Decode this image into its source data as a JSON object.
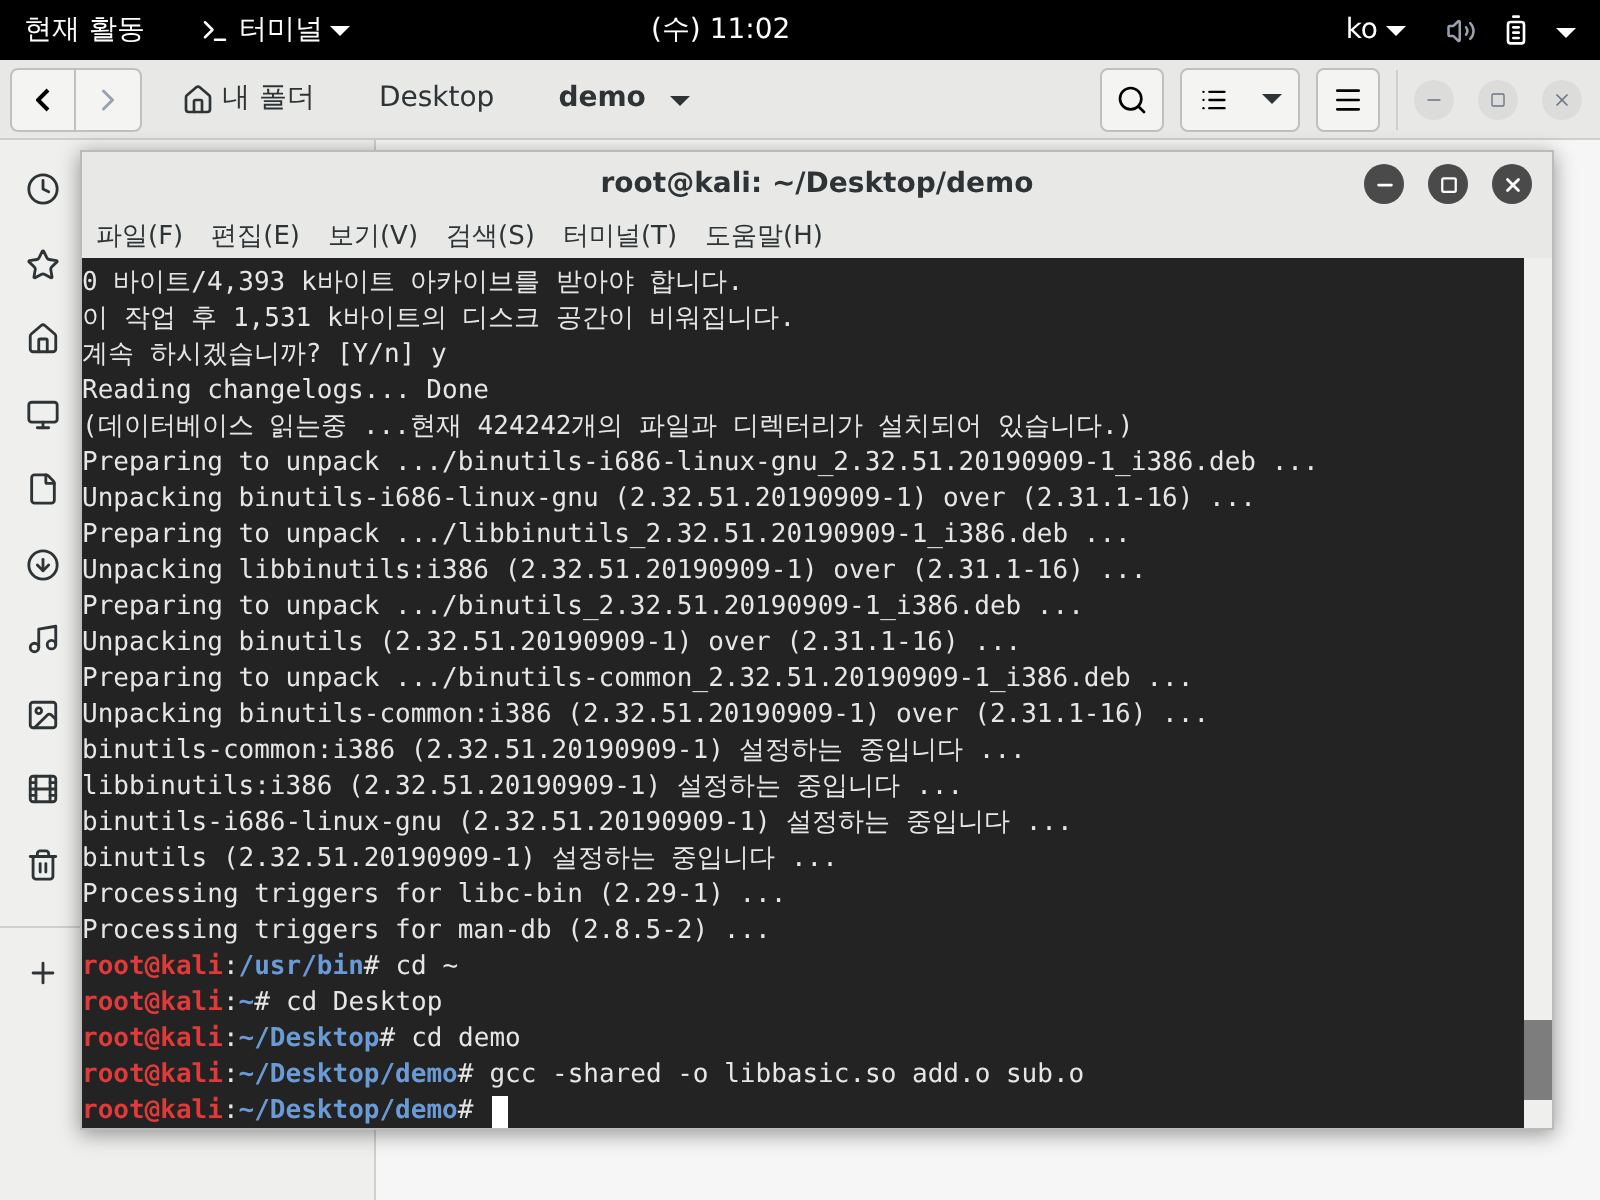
{
  "top_bar": {
    "activities": "현재 활동",
    "app_menu": "터미널",
    "clock": "(수) 11:02",
    "input_method": "ko"
  },
  "file_manager": {
    "path": [
      {
        "label": "내 폴더",
        "kind": "home",
        "selected": false
      },
      {
        "label": "Desktop",
        "kind": "plain",
        "selected": false
      },
      {
        "label": "demo",
        "kind": "dropdown",
        "selected": true
      }
    ]
  },
  "terminal": {
    "title": "root@kali: ~/Desktop/demo",
    "menu": [
      "파일(F)",
      "편집(E)",
      "보기(V)",
      "검색(S)",
      "터미널(T)",
      "도움말(H)"
    ],
    "lines": [
      {
        "kind": "output",
        "text": "0 바이트/4,393 k바이트 아카이브를 받아야 합니다."
      },
      {
        "kind": "output",
        "text": "이 작업 후 1,531 k바이트의 디스크 공간이 비워집니다."
      },
      {
        "kind": "output",
        "text": "계속 하시겠습니까? [Y/n] y"
      },
      {
        "kind": "output",
        "text": "Reading changelogs... Done"
      },
      {
        "kind": "output",
        "text": "(데이터베이스 읽는중 ...현재 424242개의 파일과 디렉터리가 설치되어 있습니다.)"
      },
      {
        "kind": "output",
        "text": "Preparing to unpack .../binutils-i686-linux-gnu_2.32.51.20190909-1_i386.deb ..."
      },
      {
        "kind": "output",
        "text": "Unpacking binutils-i686-linux-gnu (2.32.51.20190909-1) over (2.31.1-16) ..."
      },
      {
        "kind": "output",
        "text": "Preparing to unpack .../libbinutils_2.32.51.20190909-1_i386.deb ..."
      },
      {
        "kind": "output",
        "text": "Unpacking libbinutils:i386 (2.32.51.20190909-1) over (2.31.1-16) ..."
      },
      {
        "kind": "output",
        "text": "Preparing to unpack .../binutils_2.32.51.20190909-1_i386.deb ..."
      },
      {
        "kind": "output",
        "text": "Unpacking binutils (2.32.51.20190909-1) over (2.31.1-16) ..."
      },
      {
        "kind": "output",
        "text": "Preparing to unpack .../binutils-common_2.32.51.20190909-1_i386.deb ..."
      },
      {
        "kind": "output",
        "text": "Unpacking binutils-common:i386 (2.32.51.20190909-1) over (2.31.1-16) ..."
      },
      {
        "kind": "output",
        "text": "binutils-common:i386 (2.32.51.20190909-1) 설정하는 중입니다 ..."
      },
      {
        "kind": "output",
        "text": "libbinutils:i386 (2.32.51.20190909-1) 설정하는 중입니다 ..."
      },
      {
        "kind": "output",
        "text": "binutils-i686-linux-gnu (2.32.51.20190909-1) 설정하는 중입니다 ..."
      },
      {
        "kind": "output",
        "text": "binutils (2.32.51.20190909-1) 설정하는 중입니다 ..."
      },
      {
        "kind": "output",
        "text": "Processing triggers for libc-bin (2.29-1) ..."
      },
      {
        "kind": "output",
        "text": "Processing triggers for man-db (2.8.5-2) ..."
      },
      {
        "kind": "prompt",
        "user": "root@kali",
        "sep": ":",
        "path": "/usr/bin",
        "mark": "#",
        "command": "cd ~"
      },
      {
        "kind": "prompt",
        "user": "root@kali",
        "sep": ":",
        "path": "~",
        "mark": "#",
        "command": "cd Desktop"
      },
      {
        "kind": "prompt",
        "user": "root@kali",
        "sep": ":",
        "path": "~/Desktop",
        "mark": "#",
        "command": "cd demo"
      },
      {
        "kind": "prompt",
        "user": "root@kali",
        "sep": ":",
        "path": "~/Desktop/demo",
        "mark": "#",
        "command": "gcc -shared -o libbasic.so add.o sub.o"
      },
      {
        "kind": "prompt",
        "user": "root@kali",
        "sep": ":",
        "path": "~/Desktop/demo",
        "mark": "#",
        "cursor": true
      }
    ]
  }
}
